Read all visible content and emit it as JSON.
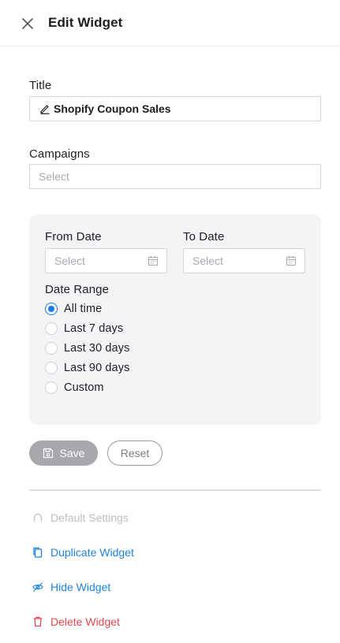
{
  "header": {
    "title": "Edit Widget",
    "close_icon": "close-icon"
  },
  "form": {
    "title_label": "Title",
    "title_value": "Shopify Coupon Sales",
    "campaigns_label": "Campaigns",
    "campaigns_placeholder": "Select"
  },
  "dates": {
    "from_label": "From Date",
    "from_placeholder": "Select",
    "to_label": "To Date",
    "to_placeholder": "Select",
    "range_label": "Date Range",
    "options": [
      {
        "label": "All time",
        "checked": true
      },
      {
        "label": "Last 7 days",
        "checked": false
      },
      {
        "label": "Last 30 days",
        "checked": false
      },
      {
        "label": "Last 90 days",
        "checked": false
      },
      {
        "label": "Custom",
        "checked": false
      }
    ]
  },
  "buttons": {
    "save": "Save",
    "reset": "Reset"
  },
  "actions": {
    "default_settings": "Default Settings",
    "duplicate": "Duplicate Widget",
    "hide": "Hide Widget",
    "delete": "Delete Widget"
  },
  "colors": {
    "accent": "#1479ea",
    "link_blue": "#1f84e0",
    "danger": "#e5484d",
    "panel_bg": "#f4f4f6",
    "save_bg": "#a8a8ac"
  }
}
